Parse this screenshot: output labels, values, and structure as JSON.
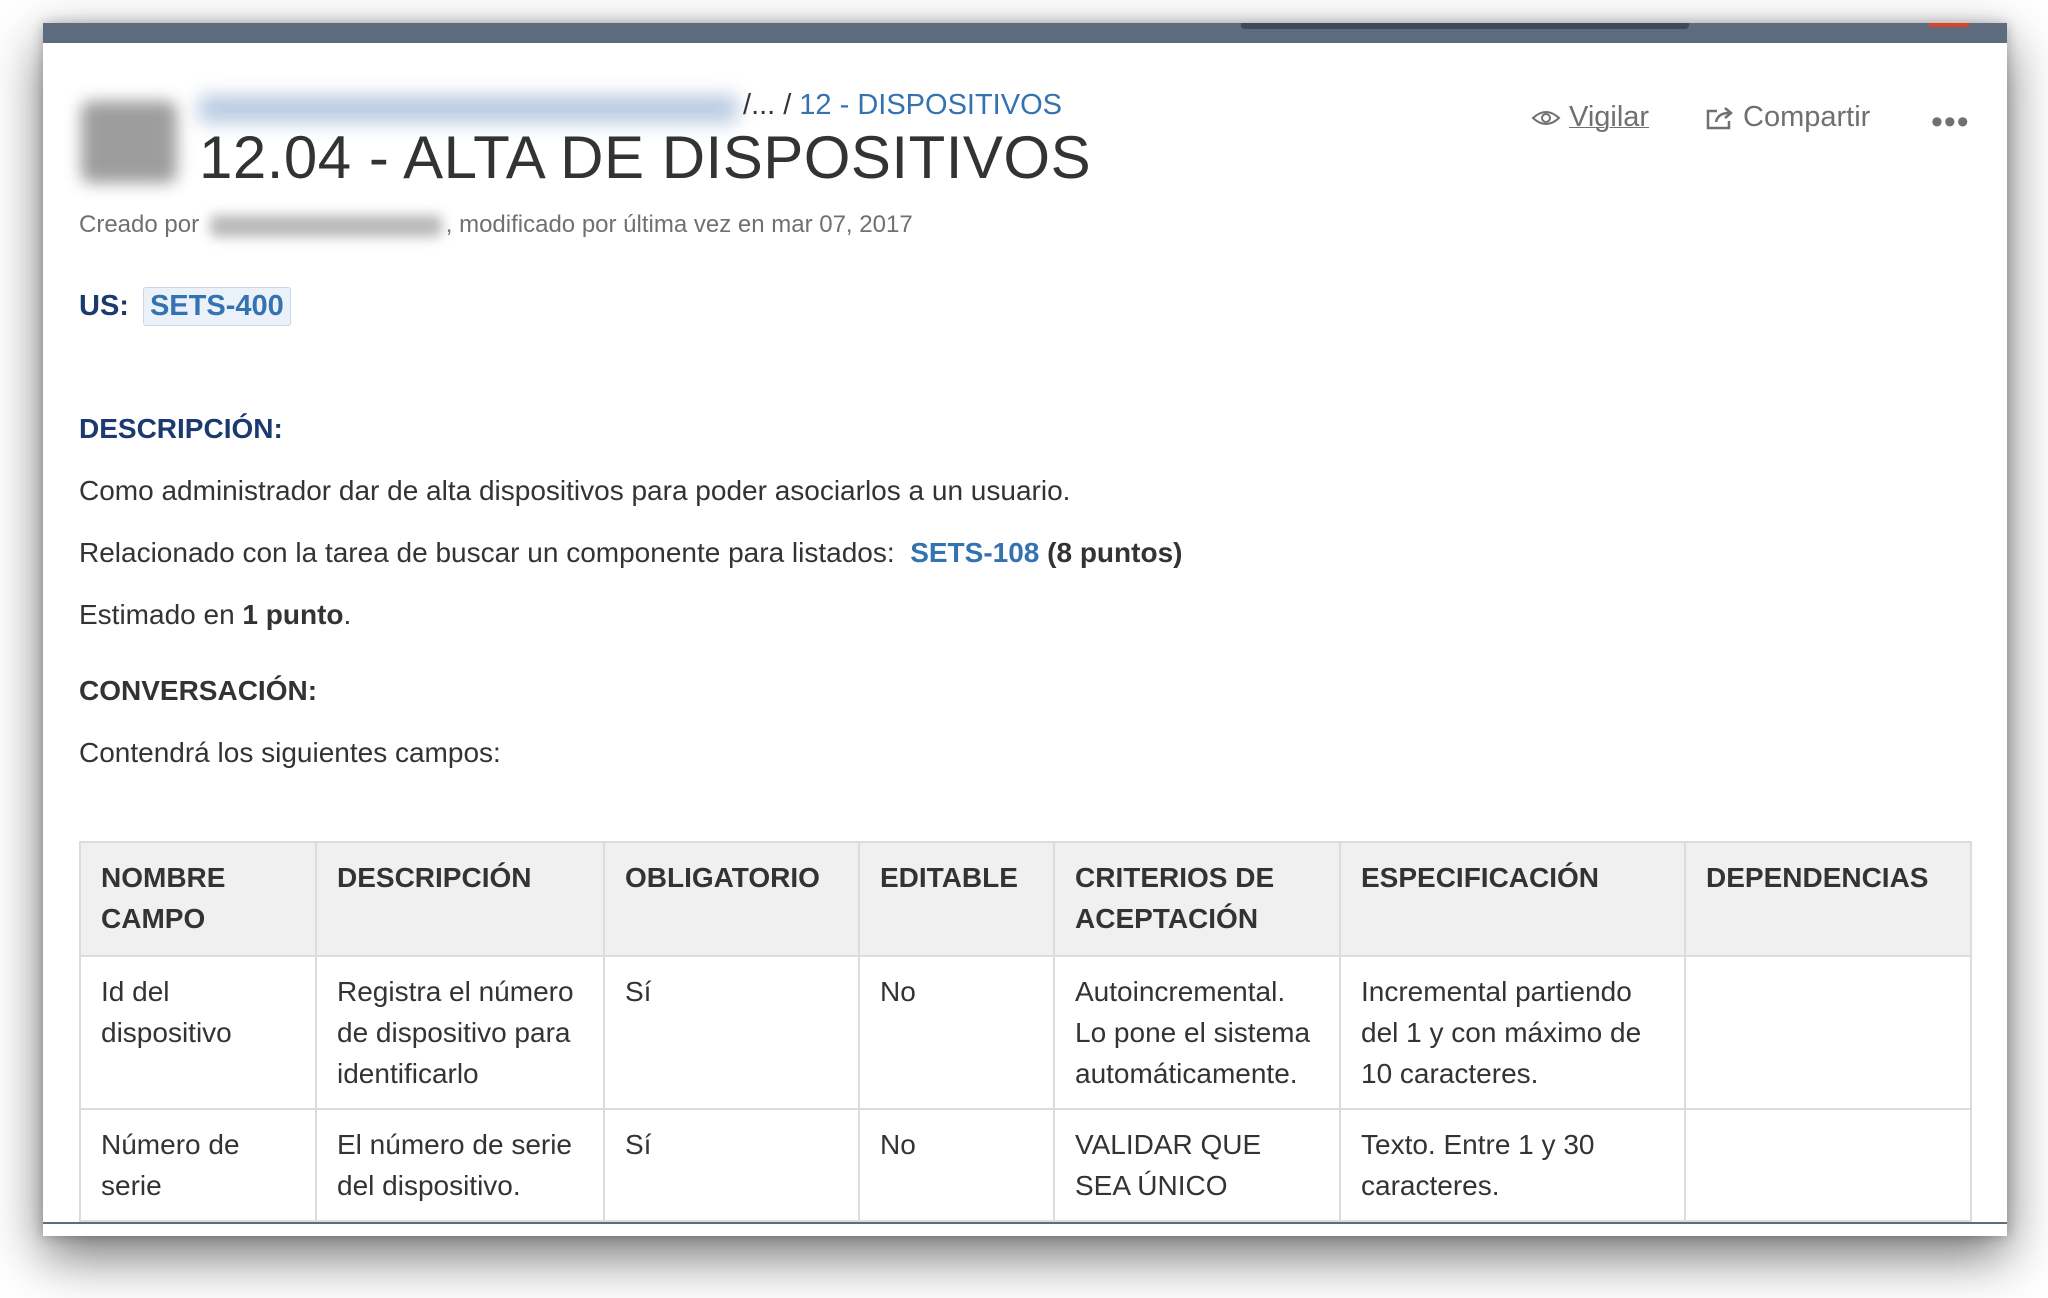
{
  "breadcrumb": {
    "ellipsis": "...",
    "separator": "/",
    "parent_link": "12 - DISPOSITIVOS"
  },
  "page": {
    "title": "12.04 - ALTA DE DISPOSITIVOS",
    "created_by_label": "Creado por",
    "modified_text": ", modificado por última vez en mar 07, 2017"
  },
  "actions": {
    "watch_label": "Vigilar",
    "share_label": "Compartir",
    "more_label": "•••"
  },
  "us": {
    "label": "US:",
    "issue": "SETS-400"
  },
  "description": {
    "heading": "DESCRIPCIÓN:",
    "line1": "Como administrador dar de alta dispositivos para poder asociarlos a un usuario.",
    "line2_prefix": "Relacionado con la tarea de buscar un componente para listados:",
    "line2_link": "SETS-108",
    "line2_suffix": "(8 puntos)",
    "line3_prefix": "Estimado en",
    "line3_bold": "1 punto",
    "line3_suffix": "."
  },
  "conversation": {
    "heading": "CONVERSACIÓN:",
    "intro": "Contendrá los siguientes campos:"
  },
  "table": {
    "headers": [
      "NOMBRE CAMPO",
      "DESCRIPCIÓN",
      "OBLIGATORIO",
      "EDITABLE",
      "CRITERIOS DE ACEPTACIÓN",
      "ESPECIFICACIÓN",
      "DEPENDENCIAS"
    ],
    "rows": [
      [
        "Id del dispositivo",
        "Registra el número de dispositivo para identificarlo",
        "Sí",
        "No",
        "Autoincremental. Lo pone el sistema automáticamente.",
        "Incremental partiendo del 1 y con máximo de 10 caracteres.",
        ""
      ],
      [
        "Número de serie",
        "El número de serie del dispositivo.",
        "Sí",
        "No",
        "VALIDAR QUE SEA ÚNICO",
        "Texto. Entre 1 y 30 caracteres.",
        ""
      ]
    ]
  },
  "icons": {
    "watch": "eye-icon",
    "share": "share-icon",
    "more": "more-icon"
  },
  "colors": {
    "link": "#3572b0",
    "heading": "#1b3a70",
    "topbar": "#5c6b7e"
  }
}
